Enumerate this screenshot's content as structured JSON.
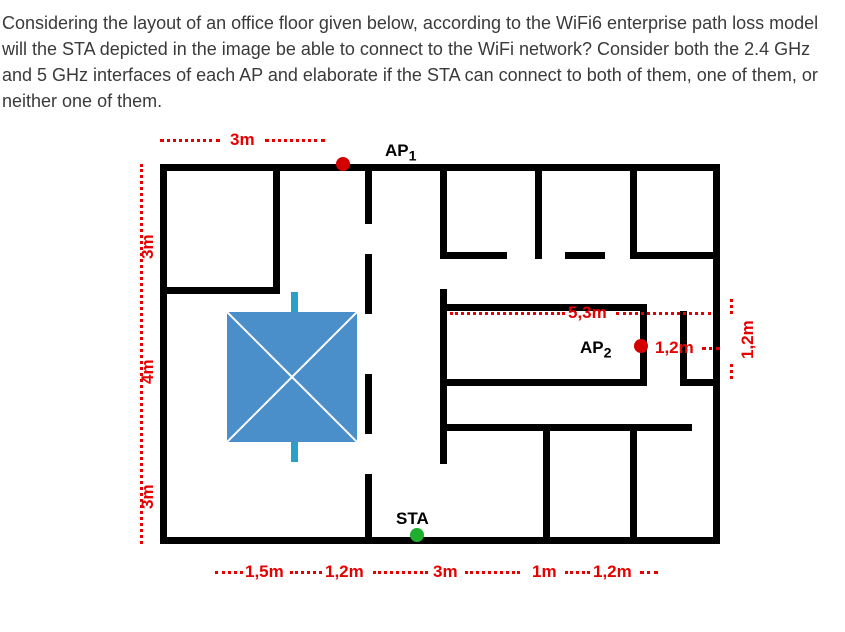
{
  "question": "Considering the layout of an office floor given below, according to the WiFi6 enterprise path loss model will the STA depicted in the image be able to connect to the WiFi network? Consider both the 2.4 GHz and 5 GHz interfaces of each AP and elaborate if the STA can connect to both of them, one of them, or neither one of them.",
  "labels": {
    "ap1": "AP",
    "ap1_sub": "1",
    "ap2": "AP",
    "ap2_sub": "2",
    "sta": "STA"
  },
  "dimensions": {
    "top_3m": "3m",
    "left_top_3m": "3m",
    "left_mid_4m": "4m",
    "left_bot_3m": "3m",
    "mid_5_3m": "5,3m",
    "ap2_1_2m": "1,2m",
    "right_1_2m": "1,2m",
    "bottom_1_5m": "1,5m",
    "bottom_1_2m_a": "1,2m",
    "bottom_3m": "3m",
    "bottom_1m": "1m",
    "bottom_1_2m_b": "1,2m"
  }
}
